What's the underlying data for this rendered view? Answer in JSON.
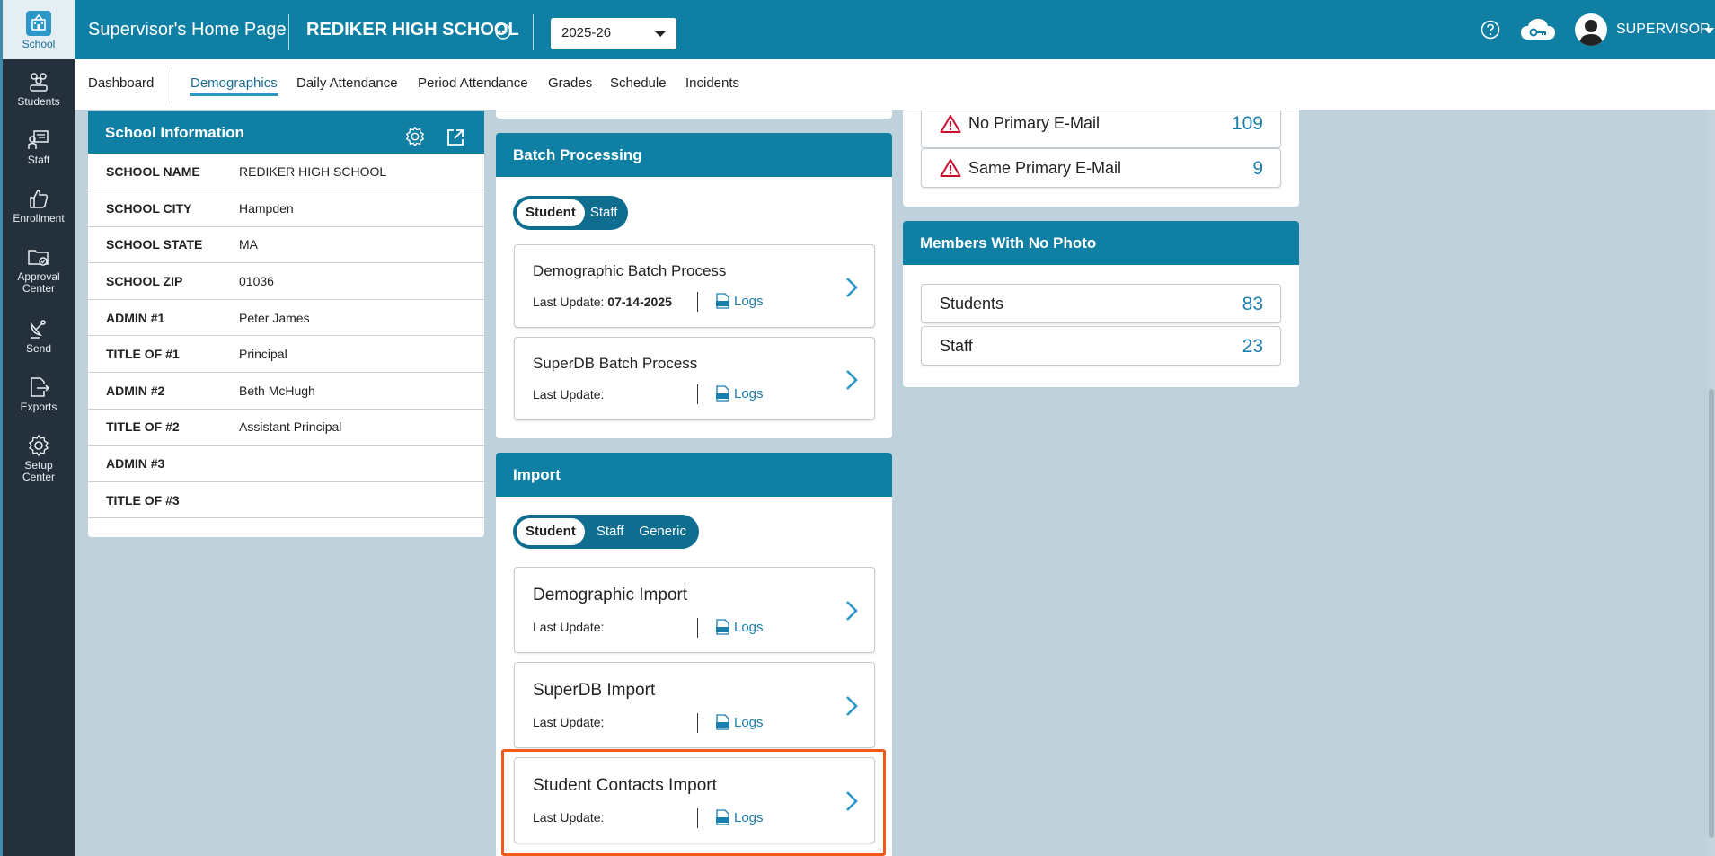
{
  "sidebar": {
    "items": [
      {
        "label": "School",
        "icon": "school-icon"
      },
      {
        "label": "Students",
        "icon": "students-icon"
      },
      {
        "label": "Staff",
        "icon": "staff-icon"
      },
      {
        "label": "Enrollment",
        "icon": "thumbs-up-icon"
      },
      {
        "label_l1": "Approval",
        "label_l2": "Center",
        "icon": "folder-check-icon"
      },
      {
        "label": "Send",
        "icon": "satellite-icon"
      },
      {
        "label": "Exports",
        "icon": "export-icon"
      },
      {
        "label_l1": "Setup",
        "label_l2": "Center",
        "icon": "gear-icon"
      }
    ]
  },
  "header": {
    "title": "Supervisor's Home Page",
    "school": "REDIKER HIGH SCHOOL",
    "year": "2025-26",
    "user": "SUPERVISOR"
  },
  "subnav": {
    "tabs": [
      "Dashboard",
      "Demographics",
      "Daily Attendance",
      "Period Attendance",
      "Grades",
      "Schedule",
      "Incidents"
    ],
    "active": "Demographics"
  },
  "school_info": {
    "title": "School Information",
    "rows": [
      {
        "k": "SCHOOL NAME",
        "v": "REDIKER HIGH SCHOOL"
      },
      {
        "k": "SCHOOL CITY",
        "v": "Hampden"
      },
      {
        "k": "SCHOOL STATE",
        "v": "MA"
      },
      {
        "k": "SCHOOL ZIP",
        "v": "01036"
      },
      {
        "k": "ADMIN #1",
        "v": "Peter James"
      },
      {
        "k": "TITLE OF #1",
        "v": "Principal"
      },
      {
        "k": "ADMIN #2",
        "v": "Beth McHugh"
      },
      {
        "k": "TITLE OF #2",
        "v": "Assistant Principal"
      },
      {
        "k": "ADMIN #3",
        "v": ""
      },
      {
        "k": "TITLE OF #3",
        "v": ""
      }
    ]
  },
  "batch": {
    "title": "Batch Processing",
    "toggle": [
      "Student",
      "Staff"
    ],
    "items": [
      {
        "title": "Demographic Batch Process",
        "last_update_label": "Last Update:",
        "date": "07-14-2025",
        "logs": "Logs"
      },
      {
        "title": "SuperDB Batch Process",
        "last_update_label": "Last Update:",
        "date": "",
        "logs": "Logs"
      }
    ]
  },
  "import": {
    "title": "Import",
    "toggle": [
      "Student",
      "Staff",
      "Generic"
    ],
    "items": [
      {
        "title": "Demographic Import",
        "last_update_label": "Last Update:",
        "logs": "Logs"
      },
      {
        "title": "SuperDB Import",
        "last_update_label": "Last Update:",
        "logs": "Logs"
      },
      {
        "title": "Student Contacts Import",
        "last_update_label": "Last Update:",
        "logs": "Logs"
      }
    ]
  },
  "email_stats": [
    {
      "label": "No Primary E-Mail",
      "value": "109"
    },
    {
      "label": "Same Primary E-Mail",
      "value": "9"
    }
  ],
  "no_photo": {
    "title": "Members With No Photo",
    "rows": [
      {
        "label": "Students",
        "value": "83"
      },
      {
        "label": "Staff",
        "value": "23"
      }
    ]
  },
  "colors": {
    "brand": "#0f7fa3",
    "sidebar": "#24313d",
    "highlight": "#f05a1a",
    "link": "#1b7fae",
    "warn": "#c8102e"
  }
}
